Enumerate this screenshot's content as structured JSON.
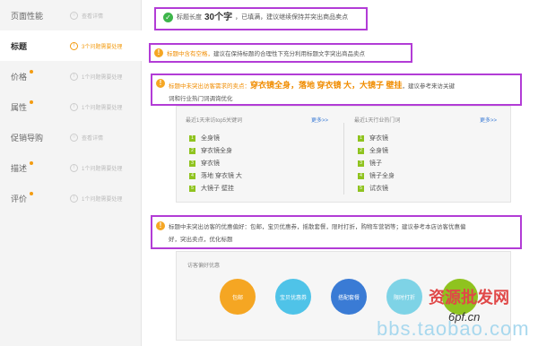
{
  "nav": {
    "items": [
      {
        "label": "页面性能",
        "status": "查看详情",
        "active": false,
        "dot": false
      },
      {
        "label": "标题",
        "status": "3个问题需要处理",
        "active": true,
        "dot": false
      },
      {
        "label": "价格",
        "status": "1个问题需要处理",
        "active": false,
        "dot": true
      },
      {
        "label": "属性",
        "status": "1个问题需要处理",
        "active": false,
        "dot": true
      },
      {
        "label": "促销导购",
        "status": "查看详情",
        "active": false,
        "dot": false
      },
      {
        "label": "描述",
        "status": "1个问题需要处理",
        "active": false,
        "dot": true
      },
      {
        "label": "评价",
        "status": "1个问题需要处理",
        "active": false,
        "dot": true
      }
    ]
  },
  "title_check": {
    "ok": {
      "prefix": "标题长度",
      "count": "30个字",
      "suffix": "，已填满，建议继续保持并突出商品卖点"
    },
    "warn_space": {
      "lead": "标题中含有空格，",
      "text": "建议在保持标题的合理性下充分利用标题文字突出商品卖点"
    },
    "warn_keywords": {
      "lead": "标题中未突出访客需求的卖点：",
      "keywords": "穿衣镜全身，落地 穿衣镜 大，大镜子 壁挂",
      "text": "，建议参考来访关键",
      "text2": "词和行业热门词调询优化"
    },
    "warn_pref": {
      "line1": "标题中未突出访客的优惠偏好：包邮，宝贝优惠券，摇散套餐，限时打折，购物车营销等；建议参考本店访客优惠偏",
      "line2": "好，突出卖点，优化标题"
    }
  },
  "keywords": {
    "left": {
      "header": "最近1天来访top5关键词",
      "more": "更多>>",
      "items": [
        "全身镜",
        "穿衣镜全身",
        "穿衣镜",
        "落地 穿衣镜 大",
        "大镜子 壁挂"
      ]
    },
    "right": {
      "header": "最近1天行业热门词",
      "more": "更多>>",
      "items": [
        "穿衣镜",
        "全身镜",
        "镜子",
        "镜子全身",
        "试衣镜"
      ]
    }
  },
  "preferences": {
    "header": "访客偏好优惠",
    "items": [
      {
        "label": "包邮",
        "color": "#f5a623"
      },
      {
        "label": "宝贝优惠券",
        "color": "#4fc3e8"
      },
      {
        "label": "搭配套餐",
        "color": "#3a7bd5"
      },
      {
        "label": "限时打折",
        "color": "#7ed3e6"
      },
      {
        "label": "",
        "color": "#8fc31f"
      }
    ]
  },
  "watermark": {
    "site": "bbs.taobao.com",
    "brand": "资源批发网",
    "domain": "6pf.cn"
  },
  "colors": {
    "accent": "#f39c12",
    "highlight_box": "#b23cd6",
    "ok": "#3db54a",
    "keyword": "#f08c00"
  }
}
